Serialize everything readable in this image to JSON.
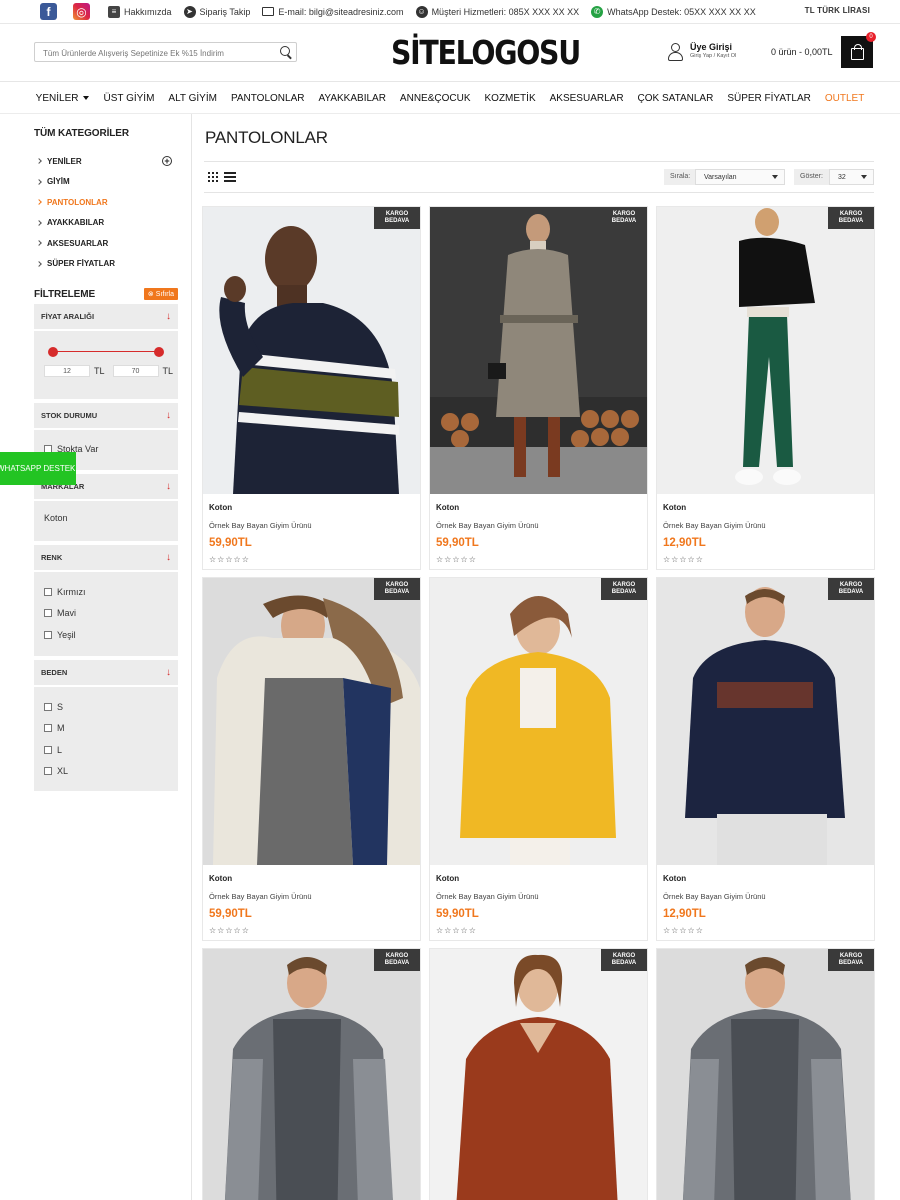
{
  "topbar": {
    "social": [
      {
        "name": "facebook-icon",
        "glyph": "f"
      },
      {
        "name": "instagram-icon",
        "glyph": "◎"
      }
    ],
    "links": [
      {
        "label": "Hakkımızda",
        "icon": "info-icon"
      },
      {
        "label": "Sipariş Takip",
        "icon": "truck-icon"
      },
      {
        "label": "E-mail: bilgi@siteadresiniz.com",
        "icon": "mail-icon"
      },
      {
        "label": "Müşteri Hizmetleri: 085X XXX XX XX",
        "icon": "headset-icon"
      },
      {
        "label": "WhatsApp Destek: 05XX XXX XX XX",
        "icon": "whatsapp-icon"
      }
    ],
    "currency": "TL  TÜRK LİRASI"
  },
  "header": {
    "search_placeholder": "Tüm Ürünlerde Alışveriş Sepetinize Ek %15 İndirim",
    "logo": "SİTELOGOSU",
    "member_title": "Üye Girişi",
    "member_sub": "Giriş Yap / Kayıt Ol",
    "cart_text": "0 ürün - 0,00TL",
    "cart_count": "0"
  },
  "nav": [
    "YENİLER",
    "ÜST GİYİM",
    "ALT GİYİM",
    "PANTOLONLAR",
    "AYAKKABILAR",
    "ANNE&ÇOCUK",
    "KOZMETİK",
    "AKSESUARLAR",
    "ÇOK SATANLAR",
    "SÜPER FİYATLAR",
    "OUTLET"
  ],
  "sidebar": {
    "title": "TÜM KATEGORİLER",
    "categories": [
      "YENİLER",
      "GİYİM",
      "PANTOLONLAR",
      "AYAKKABILAR",
      "AKSESUARLAR",
      "SÜPER FİYATLAR"
    ],
    "active_category": "PANTOLONLAR",
    "filter_title": "FİLTRELEME",
    "reset_label": "Sıfırla",
    "price_box": {
      "title": "FİYAT ARALIĞI",
      "min": "12",
      "max": "70",
      "unit": "TL"
    },
    "stock_box": {
      "title": "STOK DURUMU",
      "options": [
        "Stokta Var"
      ]
    },
    "brand_box": {
      "title": "MARKALAR",
      "options": [
        "Koton"
      ]
    },
    "color_box": {
      "title": "RENK",
      "options": [
        "Kırmızı",
        "Mavi",
        "Yeşil"
      ]
    },
    "size_box": {
      "title": "BEDEN",
      "options": [
        "S",
        "M",
        "L",
        "XL"
      ]
    }
  },
  "whatsapp_float": "WHATSAPP DESTEK",
  "main": {
    "title": "PANTOLONLAR",
    "sort_label": "Sırala:",
    "sort_value": "Varsayılan",
    "show_label": "Göster:",
    "show_value": "32"
  },
  "badge": "KARGO BEDAVA",
  "products": [
    {
      "brand": "Koton",
      "name": "Örnek Bay Bayan Giyim Ürünü",
      "price": "59,90TL",
      "rating": 0,
      "img": "sweater-stripe"
    },
    {
      "brand": "Koton",
      "name": "Örnek Bay Bayan Giyim Ürünü",
      "price": "59,90TL",
      "rating": 0,
      "img": "coat-check"
    },
    {
      "brand": "Koton",
      "name": "Örnek Bay Bayan Giyim Ürünü",
      "price": "12,90TL",
      "rating": 0,
      "img": "velvet-pants"
    },
    {
      "brand": "Koton",
      "name": "Örnek Bay Bayan Giyim Ürünü",
      "price": "59,90TL",
      "rating": 0,
      "img": "parka-fur"
    },
    {
      "brand": "Koton",
      "name": "Örnek Bay Bayan Giyim Ürünü",
      "price": "59,90TL",
      "rating": 0,
      "img": "yellow-jacket"
    },
    {
      "brand": "Koton",
      "name": "Örnek Bay Bayan Giyim Ürünü",
      "price": "12,90TL",
      "rating": 0,
      "img": "cool-sweatshirt"
    },
    {
      "brand": "",
      "name": "",
      "price": "",
      "rating": 0,
      "img": "grey-jacket"
    },
    {
      "brand": "",
      "name": "",
      "price": "",
      "rating": 0,
      "img": "rust-sweater"
    },
    {
      "brand": "",
      "name": "",
      "price": "",
      "rating": 0,
      "img": "grey-jacket-2"
    }
  ],
  "colors": {
    "accent": "#f0771d",
    "filter_red": "#d62b2b",
    "whatsapp": "#23c423",
    "badge": "#3a3a3a"
  }
}
